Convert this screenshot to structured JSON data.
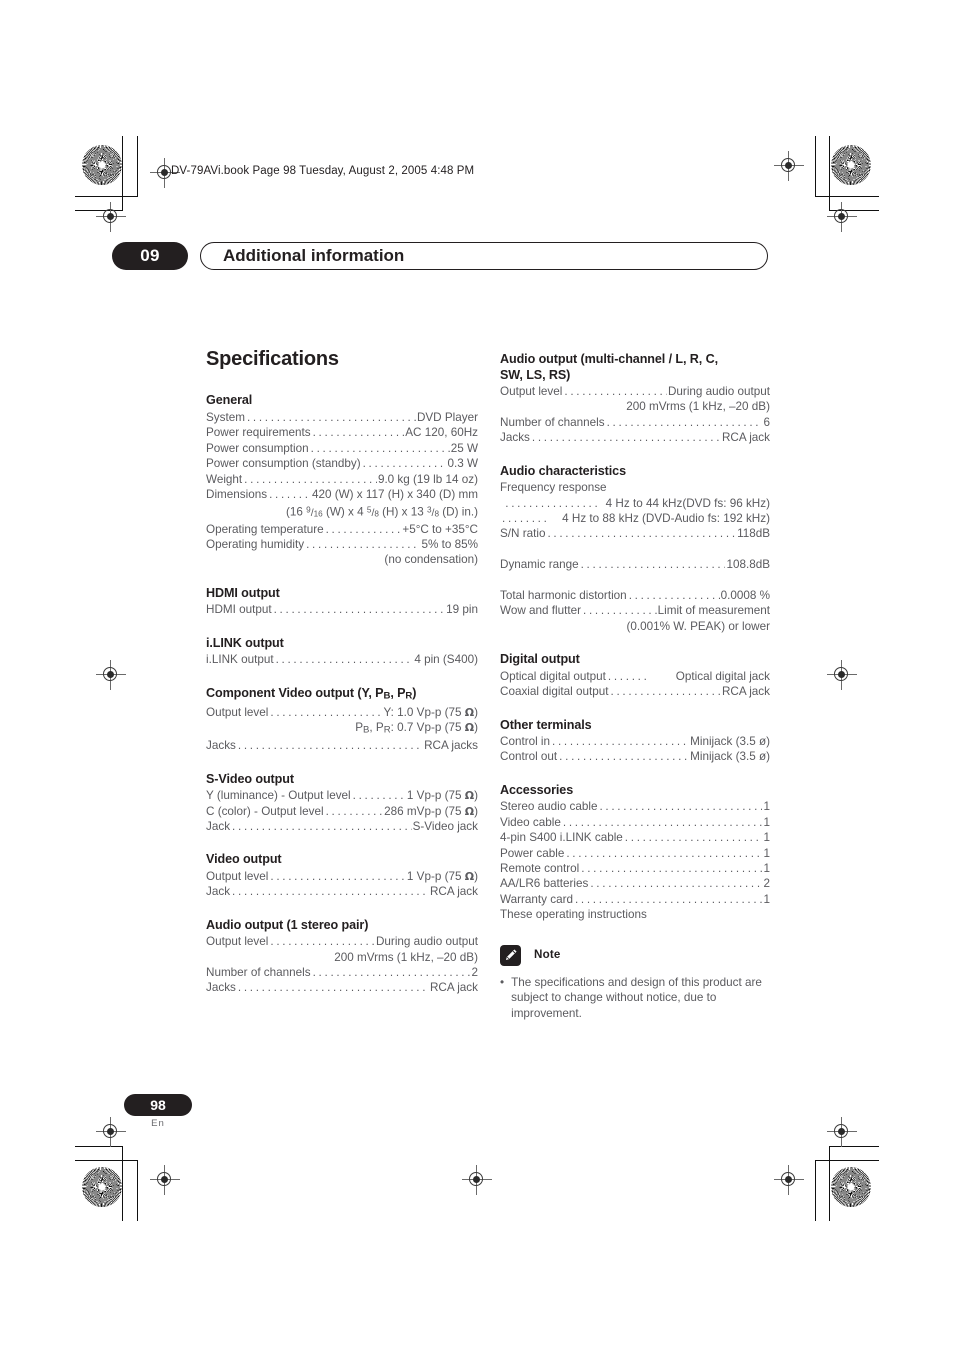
{
  "slug": "DV-79AVi.book  Page 98  Tuesday, August 2, 2005  4:48 PM",
  "header": {
    "chapter_number": "09",
    "chapter_title": "Additional information"
  },
  "page_title": "Specifications",
  "left_column": [
    {
      "heading": "General",
      "rows": [
        {
          "label": "System",
          "value": "DVD Player"
        },
        {
          "label": "Power requirements",
          "value": "AC 120, 60Hz"
        },
        {
          "label": "Power consumption",
          "value": "25 W"
        },
        {
          "label": "Power consumption (standby)",
          "value": "0.3 W"
        },
        {
          "label": "Weight",
          "value": "9.0 kg (19 lb 14 oz)"
        },
        {
          "label": "Dimensions",
          "value": "420 (W) x 117 (H) x 340 (D) mm"
        },
        {
          "cont": "(16 9/16 (W) x 4 5/8 (H) x 13 3/8 (D) in.)"
        },
        {
          "label": "Operating temperature",
          "value": "+5°C to +35°C"
        },
        {
          "label": "Operating humidity",
          "value": "5% to 85%"
        },
        {
          "cont": "(no condensation)"
        }
      ]
    },
    {
      "heading": "HDMI output",
      "rows": [
        {
          "label": "HDMI output",
          "value": "19 pin"
        }
      ]
    },
    {
      "heading": "i.LINK output",
      "rows": [
        {
          "label": "i.LINK output",
          "value": "4 pin (S400)"
        }
      ]
    },
    {
      "heading": "Component Video output (Y, PB, PR)",
      "rows": [
        {
          "label": "Output level",
          "value": "Y: 1.0 Vp-p (75 Ω)"
        },
        {
          "cont": "PB, PR: 0.7 Vp-p (75 Ω)"
        },
        {
          "label": "Jacks",
          "value": "RCA jacks"
        }
      ]
    },
    {
      "heading": "S-Video output",
      "rows": [
        {
          "label": "Y (luminance) - Output level",
          "value": "1 Vp-p (75 Ω)"
        },
        {
          "label": "C (color) - Output level",
          "value": "286 mVp-p (75 Ω)"
        },
        {
          "label": "Jack",
          "value": "S-Video jack"
        }
      ]
    },
    {
      "heading": "Video output",
      "rows": [
        {
          "label": "Output level",
          "value": "1 Vp-p (75 Ω)"
        },
        {
          "label": "Jack",
          "value": "RCA jack"
        }
      ]
    },
    {
      "heading": "Audio output (1 stereo pair)",
      "rows": [
        {
          "label": "Output level",
          "value": "During audio output"
        },
        {
          "cont": "200 mVrms (1 kHz, –20 dB)"
        },
        {
          "label": "Number of channels",
          "value": "2"
        },
        {
          "label": "Jacks",
          "value": "RCA jack"
        }
      ]
    }
  ],
  "right_column": [
    {
      "heading": "Audio output (multi-channel / L, R, C, SW, LS, RS)",
      "rows": [
        {
          "label": "Output level",
          "value": "During audio output"
        },
        {
          "cont": "200 mVrms (1 kHz, –20 dB)"
        },
        {
          "label": "Number of channels",
          "value": "6"
        },
        {
          "label": "Jacks",
          "value": "RCA jack"
        }
      ]
    },
    {
      "heading": "Audio characteristics",
      "rows": [
        {
          "plain": "Frequency response"
        },
        {
          "leadrow": "4 Hz to 44 kHz(DVD fs: 96 kHz)"
        },
        {
          "leadrow2": "4 Hz to 88 kHz (DVD-Audio fs: 192 kHz)"
        },
        {
          "label": "S/N ratio",
          "value": "118dB"
        },
        {
          "blank": true
        },
        {
          "label": "Dynamic range",
          "value": "108.8dB"
        },
        {
          "blank": true
        },
        {
          "label": "Total harmonic distortion",
          "value": "0.0008 %"
        },
        {
          "label": "Wow and flutter",
          "value": "Limit of measurement"
        },
        {
          "cont": "(0.001% W. PEAK) or lower"
        }
      ]
    },
    {
      "heading": "Digital output",
      "rows": [
        {
          "label": "Optical digital output",
          "value": "Optical digital jack"
        },
        {
          "label": "Coaxial digital output",
          "value": "RCA jack"
        }
      ]
    },
    {
      "heading": "Other terminals",
      "rows": [
        {
          "label": "Control in",
          "value": "Minijack (3.5 ø)"
        },
        {
          "label": "Control out",
          "value": "Minijack (3.5 ø)"
        }
      ]
    },
    {
      "heading": "Accessories",
      "rows": [
        {
          "label": "Stereo audio cable",
          "value": "1"
        },
        {
          "label": "Video cable",
          "value": "1"
        },
        {
          "label": "4-pin S400 i.LINK cable",
          "value": "1"
        },
        {
          "label": "Power cable",
          "value": "1"
        },
        {
          "label": "Remote control",
          "value": "1"
        },
        {
          "label": "AA/LR6 batteries",
          "value": "2"
        },
        {
          "label": "Warranty card",
          "value": "1"
        },
        {
          "plain": "These operating instructions"
        }
      ]
    }
  ],
  "note": {
    "icon": "pencil-icon",
    "label": "Note",
    "bullet": "•",
    "text": "The specifications and design of this product are subject to change without notice, due to improvement."
  },
  "footer": {
    "page_number": "98",
    "language": "En"
  },
  "colors": {
    "ink": "#231f20",
    "body_text": "#5b5b5f"
  }
}
